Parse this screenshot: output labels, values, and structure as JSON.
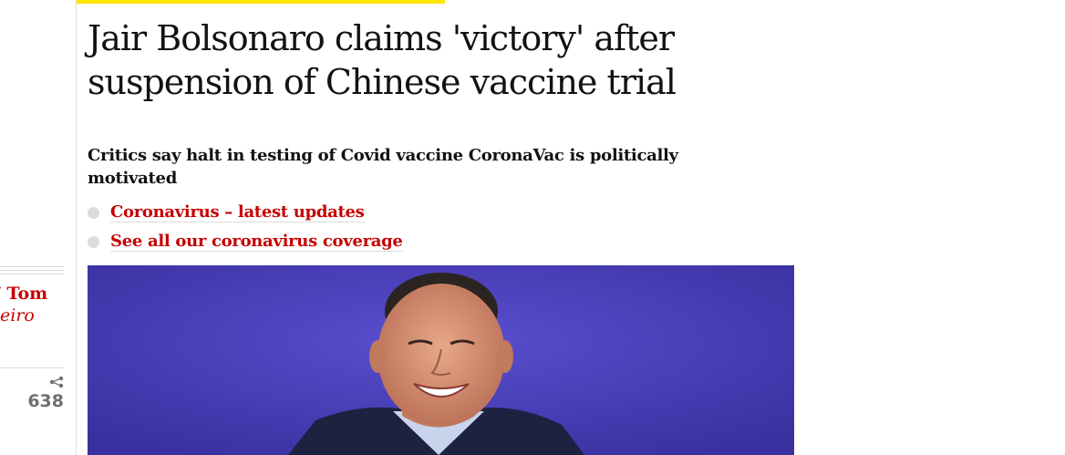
{
  "article": {
    "headline": "Jair Bolsonaro claims 'victory' after suspension of Chinese vaccine trial",
    "standfirst": "Critics say halt in testing of Covid vaccine CoronaVac is politically motivated",
    "links": [
      {
        "label": "Coronavirus – latest updates"
      },
      {
        "label": "See all our coronavirus coverage"
      }
    ],
    "byline": {
      "line1": "/ Tom",
      "line2": "eiro"
    },
    "share_count": "638"
  },
  "icons": {
    "share": "share-icon",
    "bullet": "bullet-dot"
  },
  "colors": {
    "accent_red": "#c70000",
    "yellow_bar": "#ffe500",
    "text": "#121212",
    "muted": "#707070",
    "rule": "#dcdcdc",
    "photo_background": "#4a3fb8"
  }
}
